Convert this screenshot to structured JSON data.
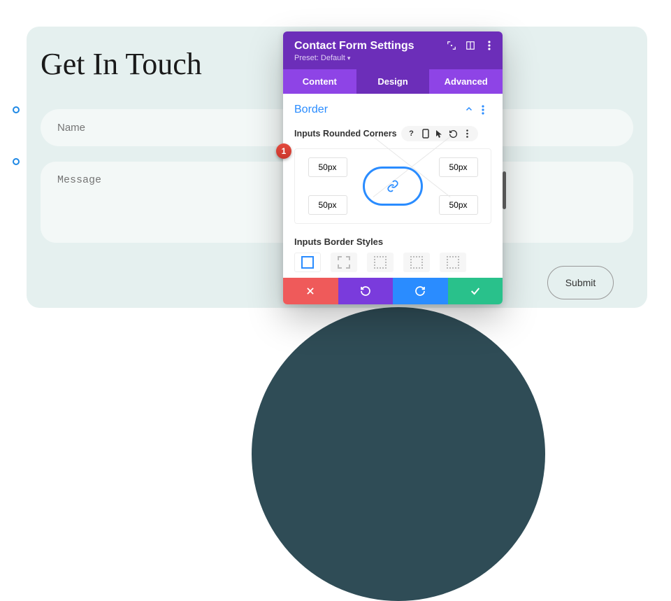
{
  "page": {
    "title": "Get In Touch",
    "name_placeholder": "Name",
    "message_placeholder": "Message",
    "submit_label": "Submit"
  },
  "modal": {
    "title": "Contact Form Settings",
    "preset_label": "Preset: Default",
    "tabs": {
      "content": "Content",
      "design": "Design",
      "advanced": "Advanced"
    },
    "active_tab": "design",
    "section": {
      "title": "Border",
      "option_label": "Inputs Rounded Corners",
      "corners": {
        "tl": "50px",
        "tr": "50px",
        "bl": "50px",
        "br": "50px"
      },
      "border_styles_label": "Inputs Border Styles"
    },
    "badge": "1"
  }
}
